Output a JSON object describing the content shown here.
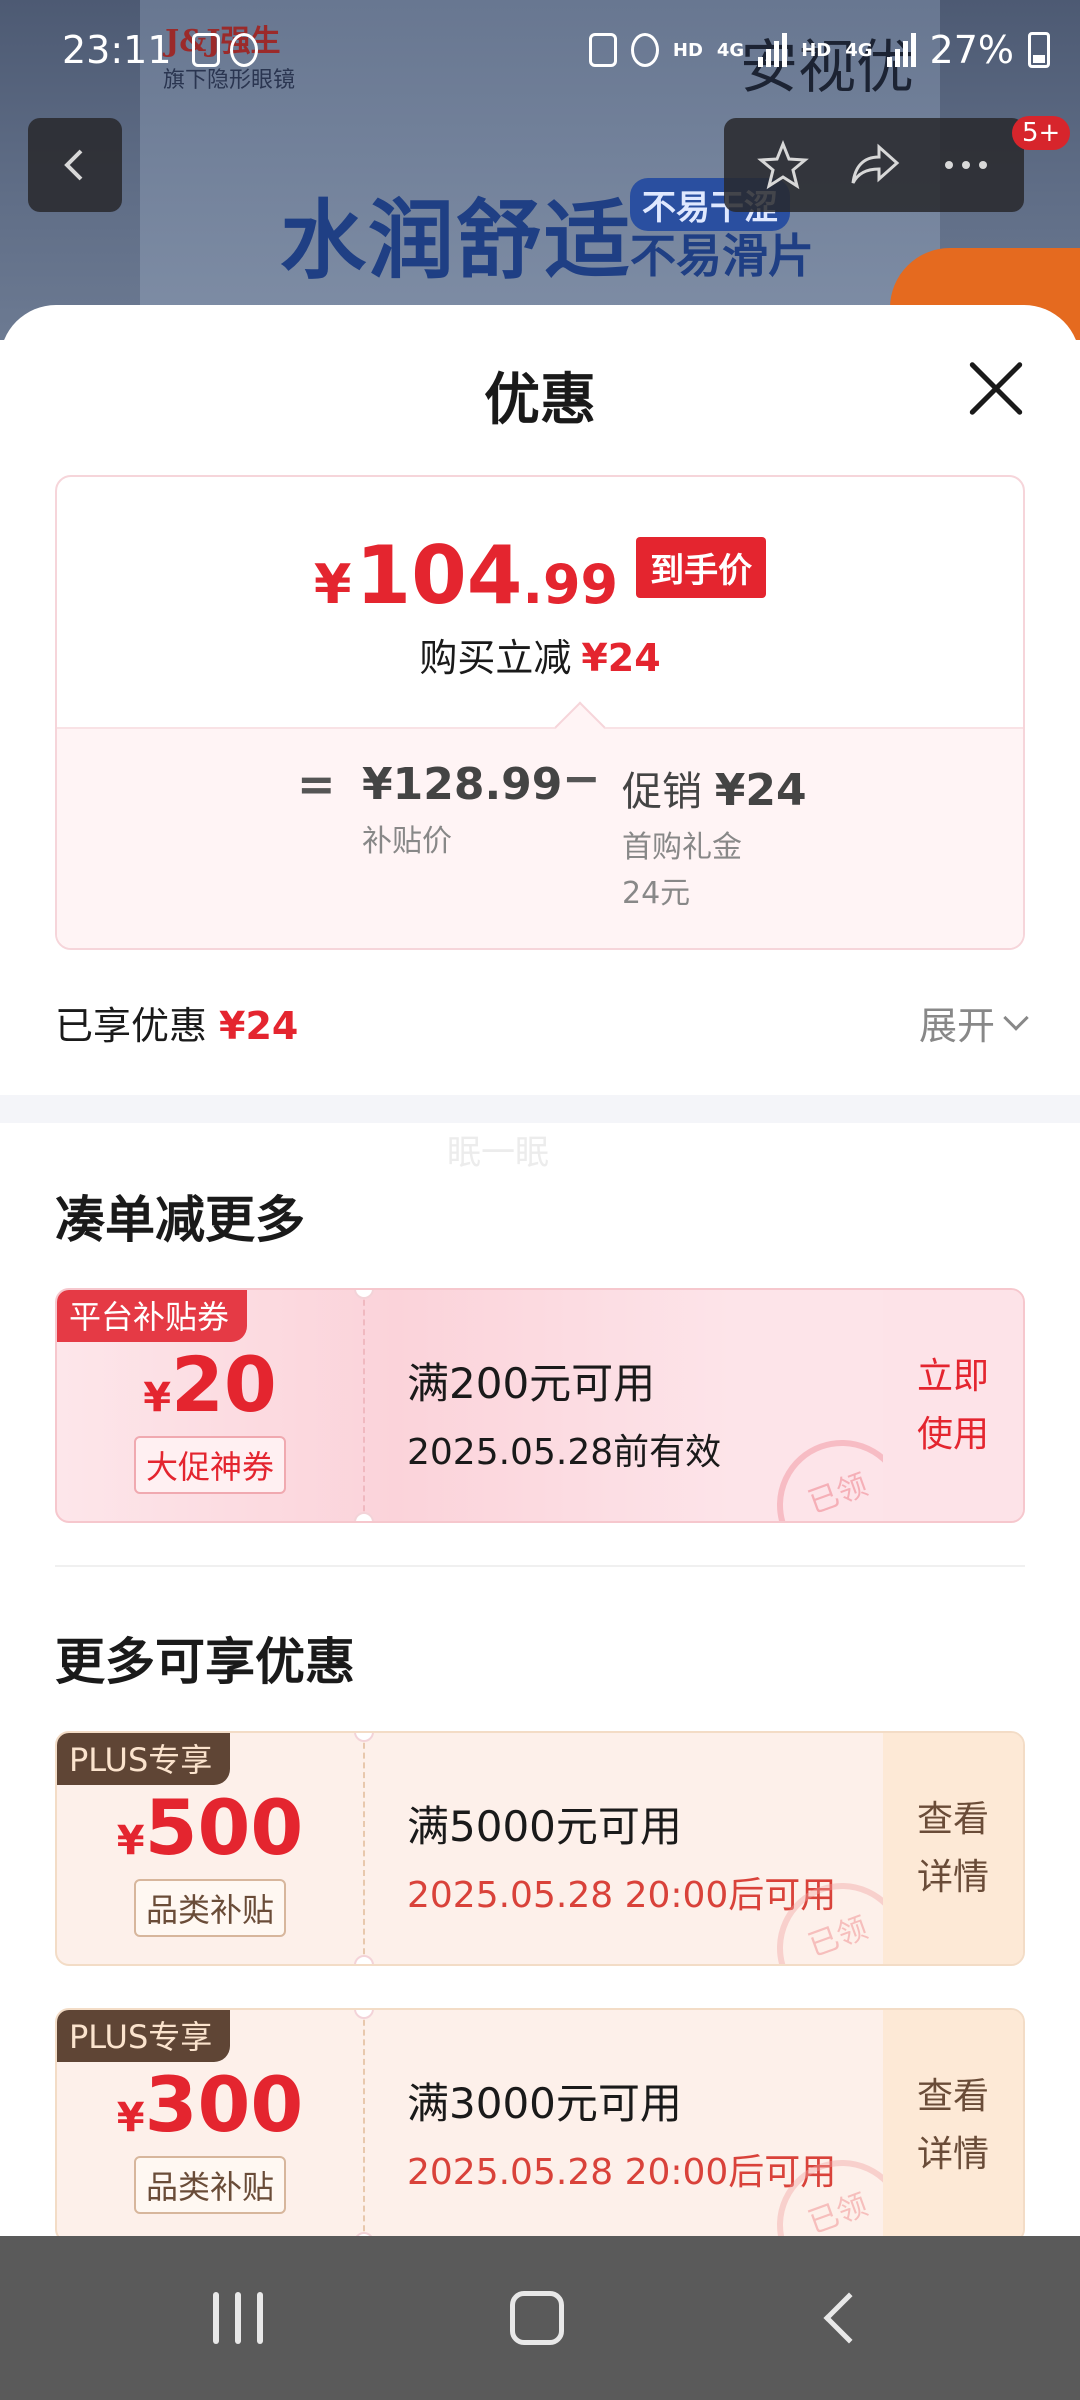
{
  "status_bar": {
    "time": "23:11",
    "battery": "27%",
    "network_1": "4G",
    "network_2": "4G",
    "hd": "HD"
  },
  "background": {
    "brand": "J&J强生",
    "brand_sub": "旗下隐形眼镜",
    "slogan": "水润舒适",
    "slogan_tag1": "不易干涩",
    "slogan_tag2": "不易滑片",
    "title_text": "安视优",
    "badge": "5+"
  },
  "sheet": {
    "title": "优惠",
    "price": {
      "symbol": "¥",
      "integer": "104",
      "decimal": ".99",
      "tag": "到手价"
    },
    "reduce": {
      "label": "购买立减",
      "amount": "¥24"
    },
    "breakdown": {
      "eq": "=",
      "subsidy_price": "¥128.99",
      "subsidy_label": "补贴价",
      "minus": "−",
      "promo_prefix": "促销",
      "promo_amount": "¥24",
      "promo_detail_1": "首购礼金",
      "promo_detail_2": "24元"
    },
    "enjoyed": {
      "label": "已享优惠",
      "amount": "¥24"
    },
    "expand_label": "展开",
    "watermark": "眠一眠"
  },
  "section1": {
    "title": "凑单减更多",
    "coupon": {
      "tag": "平台补贴券",
      "symbol": "¥",
      "amount": "20",
      "sub": "大促神券",
      "condition": "满200元可用",
      "validity": "2025.05.28前有效",
      "stamp": "已领",
      "action_line1": "立即",
      "action_line2": "使用"
    }
  },
  "section2": {
    "title": "更多可享优惠",
    "coupons": [
      {
        "tag": "PLUS专享",
        "symbol": "¥",
        "amount": "500",
        "sub": "品类补贴",
        "condition": "满5000元可用",
        "validity": "2025.05.28 20:00后可用",
        "stamp": "已领",
        "action_line1": "查看",
        "action_line2": "详情"
      },
      {
        "tag": "PLUS专享",
        "symbol": "¥",
        "amount": "300",
        "sub": "品类补贴",
        "condition": "满3000元可用",
        "validity": "2025.05.28 20:00后可用",
        "stamp": "已领",
        "action_line1": "查看",
        "action_line2": "详情"
      }
    ]
  },
  "colors": {
    "accent_red": "#e4252f",
    "plus_brown": "#5f4535",
    "nav_bar": "#5a5a5a"
  },
  "icons": [
    "back-arrow-icon",
    "star-icon",
    "share-icon",
    "more-icon",
    "close-icon",
    "chevron-down-icon",
    "recent-apps-icon",
    "home-icon",
    "back-icon"
  ]
}
